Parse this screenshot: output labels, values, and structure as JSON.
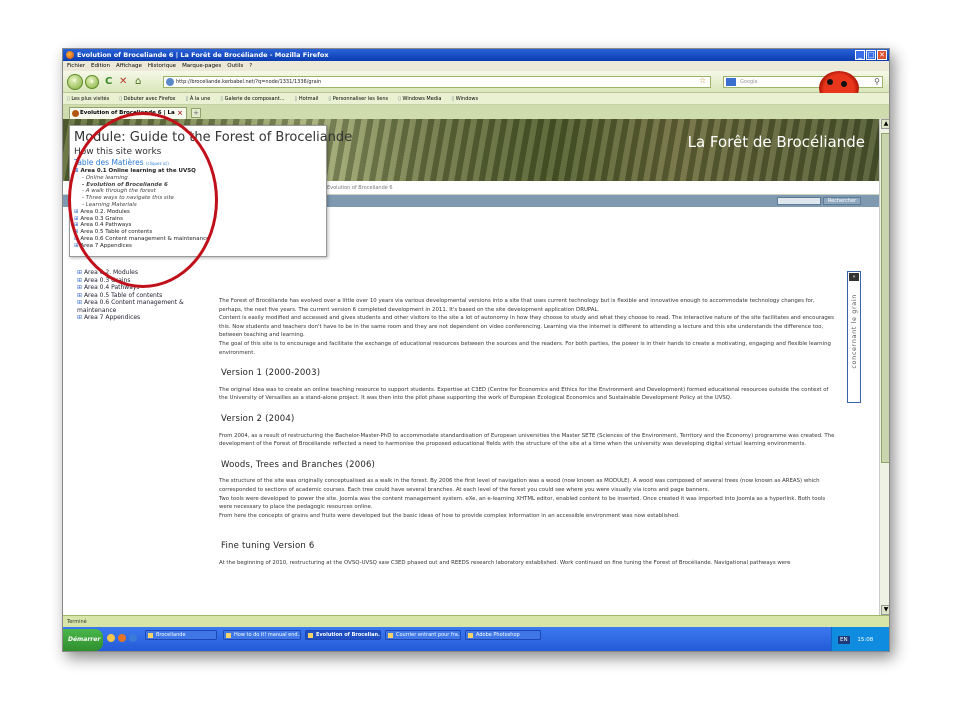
{
  "window": {
    "title": "Evolution of Broceliande 6 | La Forêt de Brocéliande - Mozilla Firefox",
    "buttons": [
      "_",
      "□",
      "✕"
    ]
  },
  "menubar": [
    "Fichier",
    "Edition",
    "Affichage",
    "Historique",
    "Marque-pages",
    "Outils",
    "?"
  ],
  "navbar": {
    "url": "http://broceliande.kerbabel.net/?q=node/1331/1336/grain",
    "search_placeholder": "Google"
  },
  "bookmarks": [
    "Les plus visités",
    "Débuter avec Firefox",
    "À la une",
    "Galerie de composant...",
    "Hotmail",
    "Personnaliser les liens",
    "Windows Media",
    "Windows"
  ],
  "tab": {
    "label": "Evolution of Broceliande 6 | La Forêt ...",
    "new_tab": "+"
  },
  "site": {
    "banner_title": "La Forêt de Brocéliande",
    "breadcrumb": "Evolution of Broceliande 6",
    "search_button": "Rechercher",
    "side_tab_label": "concernant le grain",
    "side_tab_arrow": "«"
  },
  "popup": {
    "title": "Module: Guide to the Forest of Broceliande",
    "subtitle": "How this site works",
    "toc_label": "Table des Matières",
    "toc_hint": "(cliquez ici)",
    "area_online": "Area 0.1 Online learning at the UVSQ",
    "sub_items": [
      "- Online learning",
      "- Evolution of Broceliande 6",
      "- A walk through the forest",
      "- Three ways to navigate this site",
      "- Learning Materials"
    ],
    "areas": [
      "Area 0.2. Modules",
      "Area 0.3 Grains",
      "Area 0.4 Pathways",
      "Area 0.5 Table of contents",
      "Area 0.6 Content management & maintenance",
      "Area 7 Appendices"
    ]
  },
  "leftnav": {
    "items": [
      "Area 0.2. Modules",
      "Area 0.3 Grains",
      "Area 0.4 Pathways",
      "Area 0.5 Table of contents",
      "Area 0.6 Content management & maintenance",
      "Area 7 Appendices"
    ]
  },
  "main": {
    "intro_1": "The Forest of Brocéliande has evolved over a little over 10 years via various developmental versions into a site that uses current technology but is flexible and innovative enough to accommodate technology changes for, perhaps, the next five years. The current version 6 completed development in 2011. It's based on the site development application DRUPAL.",
    "intro_2": "Content is easily modified and accessed and gives students and other visitors to the site a lot of autonomy in how they choose to study and what they choose to read. The interactive nature of the site facilitates and encourages this. Now students and teachers don't have to be in the same room and they are not dependent on video conferencing. Learning via the internet is different to attending a lecture and this site understands the difference too, between teaching and learning.",
    "intro_3": "The goal of this site is to encourage and facilitate the exchange of educational resources between the sources and the readers. For both parties, the power is in their hands to create a motivating, engaging and flexible learning environment.",
    "h_v1": "Version 1 (2000-2003)",
    "p_v1": "The original idea was to create an online teaching resource to support students.  Expertise at C3ED (Centre for Economics and Ethics for the Environment and Development) formed educational resources outside the context of the University of Versailles as a stand-alone project.  It was then into the pilot phase supporting the work of European Ecological Economics and Sustainable Development Policy at the UVSQ.",
    "h_v2": "Version 2 (2004)",
    "p_v2": "From 2004, as a result of restructuring the Bachelor-Master-PhD to accommodate standardisation of European universities the Master SETE (Sciences of the Environment, Territory and the Economy) programme was created.  The development of the Forest of Brocéliande reflected a need to harmonise the proposed educational fields with the structure of the site at a time when the university was developing digital virtual learning environments.",
    "h_woods": "Woods, Trees and Branches (2006)",
    "p_woods_1": "The structure of the site was originally conceptualised as a walk in the forest. By 2006 the first level of navigation was a wood (now known as MODULE). A wood was composed of several trees (now known as AREAS) which corresponded to sections of academic courses. Each tree could have several branches. At each level of the forest you could see where you were visually via icons and page banners.",
    "p_woods_2": "Two tools were developed to power the site.  Joomla was the content management system. eXe,  an e-learning XHTML editor, enabled content to be inserted. Once created it was imported into Joomla as a hyperlink. Both tools were necessary to place the pedagogic resources online.",
    "p_woods_3": "From here the concepts of grains and fruits were developed but the basic ideas of how to provide complex information in an accessible environment was now established.",
    "h_fine": "Fine tuning Version 6",
    "p_fine": "At the beginning of 2010, restructuring at the OVSQ-UVSQ saw C3ED phased out and REEDS research laboratory established. Work continued on fine tuning the Forest of Brocéliande. Navigational pathways were"
  },
  "statusbar": "Terminé",
  "taskbar": {
    "start": "Démarrer",
    "tasks": [
      "Broceliande",
      "How to do it! manual end...",
      "Evolution of Brocelian...",
      "Courrier entrant pour fra...",
      "Adobe Photoshop"
    ],
    "lang": "EN",
    "clock": "15:08"
  },
  "colors": {
    "accent_red": "#c0101a",
    "link_blue": "#2d7ad6",
    "titlebar_blue": "#0a3cb0"
  }
}
